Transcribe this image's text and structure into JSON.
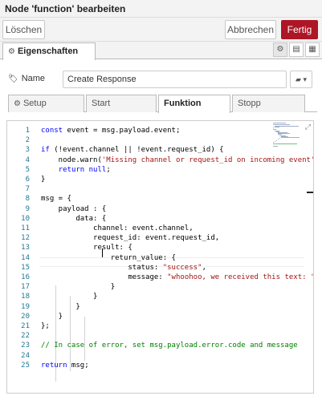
{
  "window": {
    "title": "Node 'function' bearbeiten"
  },
  "toolbar": {
    "delete_label": "Löschen",
    "cancel_label": "Abbrechen",
    "done_label": "Fertig",
    "accent": "#ad1625"
  },
  "properties_tab": {
    "label": "Eigenschaften"
  },
  "name_field": {
    "label": "Name",
    "value": "Create Response"
  },
  "subtabs": [
    {
      "label": "Setup"
    },
    {
      "label": "Start"
    },
    {
      "label": "Funktion",
      "active": true
    },
    {
      "label": "Stopp"
    }
  ],
  "code_lines": [
    {
      "n": "1",
      "text": "const event = msg.payload.event;"
    },
    {
      "n": "2",
      "text": ""
    },
    {
      "n": "3",
      "text": "if (!event.channel || !event.request_id) {"
    },
    {
      "n": "4",
      "text": "    node.warn('Missing channel or request_id on incoming event');"
    },
    {
      "n": "5",
      "text": "    return null;"
    },
    {
      "n": "6",
      "text": "}"
    },
    {
      "n": "7",
      "text": ""
    },
    {
      "n": "8",
      "text": "msg = {"
    },
    {
      "n": "9",
      "text": "    payload : {"
    },
    {
      "n": "10",
      "text": "        data: {"
    },
    {
      "n": "11",
      "text": "            channel: event.channel,"
    },
    {
      "n": "12",
      "text": "            request_id: event.request_id,"
    },
    {
      "n": "13",
      "text": "            result: {"
    },
    {
      "n": "14",
      "text": "                return_value: {"
    },
    {
      "n": "15",
      "text": "                    status: \"success\","
    },
    {
      "n": "16",
      "text": "                    message: \"whoohoo, we received this text: \" +"
    },
    {
      "n": "17",
      "text": "                }"
    },
    {
      "n": "18",
      "text": "            }"
    },
    {
      "n": "19",
      "text": "        }"
    },
    {
      "n": "20",
      "text": "    }"
    },
    {
      "n": "21",
      "text": "};"
    },
    {
      "n": "22",
      "text": ""
    },
    {
      "n": "23",
      "text": "// In case of error, set msg.payload.error.code and message"
    },
    {
      "n": "24",
      "text": ""
    },
    {
      "n": "25",
      "text": "return msg;"
    }
  ]
}
